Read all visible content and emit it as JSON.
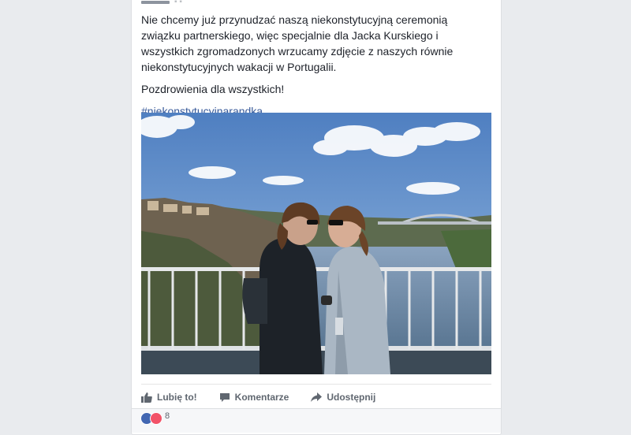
{
  "post": {
    "paragraph1": "Nie chcemy już przynudzać naszą niekonstytucyjną ceremonią związku partnerskiego, więc specjalnie dla Jacka Kurskiego i wszystkich zgromadzonych wrzucamy zdjęcie z naszych równie niekonstytucyjnych wakacji w Portugalii.",
    "paragraph2": "Pozdrowienia dla wszystkich!",
    "hashtag": "#niekonstytucyjnarandka"
  },
  "actions": {
    "like_label": "Lubię to!",
    "comment_label": "Komentarze",
    "share_label": "Udostępnij"
  },
  "reactions": {
    "count": "8"
  },
  "colors": {
    "link": "#365899",
    "text": "#1d2129",
    "muted": "#606770",
    "like": "#4267b2",
    "love": "#f25268"
  }
}
